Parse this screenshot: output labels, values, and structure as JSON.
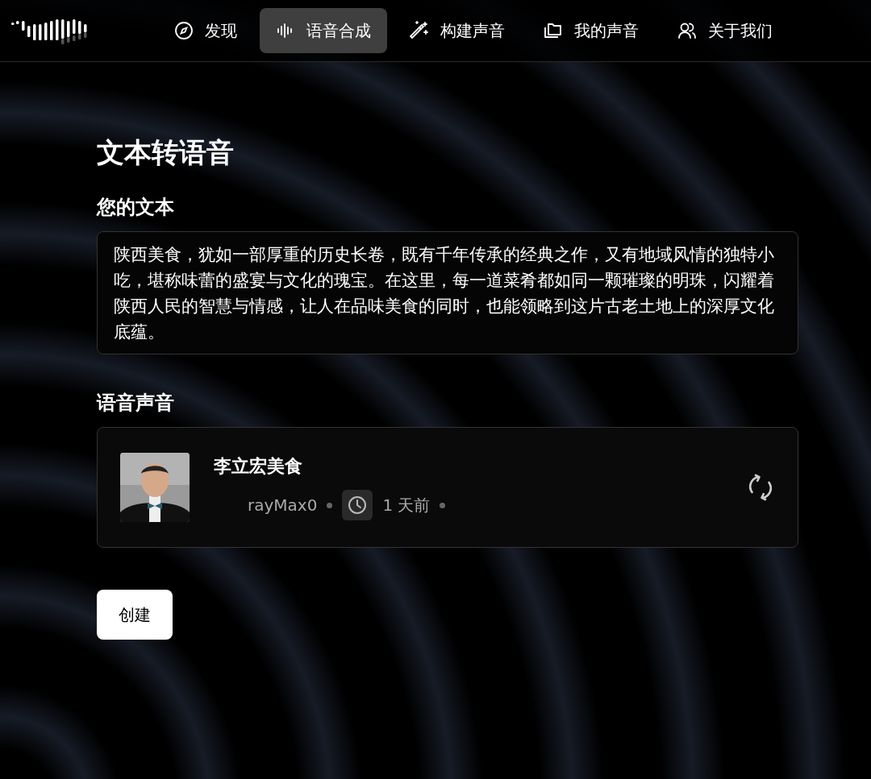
{
  "nav": {
    "items": [
      {
        "label": "发现",
        "kind": "compass",
        "selected": false
      },
      {
        "label": "语音合成",
        "kind": "wave",
        "selected": true
      },
      {
        "label": "构建声音",
        "kind": "wand",
        "selected": false
      },
      {
        "label": "我的声音",
        "kind": "folder",
        "selected": false
      },
      {
        "label": "关于我们",
        "kind": "users",
        "selected": false
      }
    ]
  },
  "page_title": "文本转语音",
  "text_section": {
    "label": "您的文本",
    "value": "陕西美食，犹如一部厚重的历史长卷，既有千年传承的经典之作，又有地域风情的独特小吃，堪称味蕾的盛宴与文化的瑰宝。在这里，每一道菜肴都如同一颗璀璨的明珠，闪耀着陕西人民的智慧与情感，让人在品味美食的同时，也能领略到这片古老土地上的深厚文化底蕴。"
  },
  "voice_section": {
    "label": "语音声音",
    "voice": {
      "kind": "picture",
      "name": "李立宏美食",
      "author": "rayMax0",
      "time": "1 天前"
    }
  },
  "create_button": "创建"
}
